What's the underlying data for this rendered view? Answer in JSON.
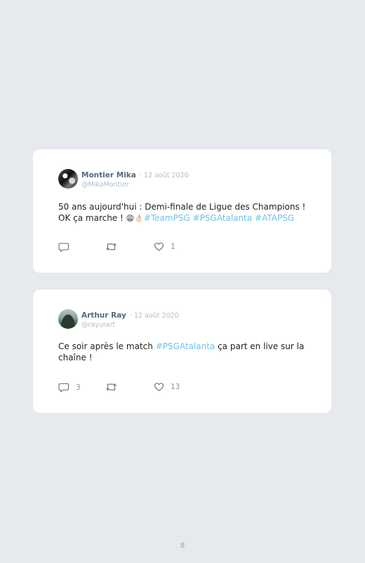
{
  "tweets": [
    {
      "name": "Montier Mika",
      "date": "· 12 août 2020",
      "handle": "@MikaMontier",
      "text_plain": "50 ans aujourd'hui : Demi-finale de Ligue des Champions !",
      "text_line2_plain": "OK ça marche ! ",
      "emoji": "😩👌🏻",
      "hashtags": [
        "#TeamPSG",
        "#PSGAtalanta",
        "#ATAPSG"
      ],
      "reply_count": "",
      "retweet_count": "",
      "like_count": "1"
    },
    {
      "name": "Arthur Ray",
      "date": "· 12 août 2020",
      "handle": "@rayurart",
      "text_before": "Ce soir après le match ",
      "hashtag": "#PSGAtalanta",
      "text_after": " ça part en live sur la chaîne !",
      "reply_count": "3",
      "retweet_count": "",
      "like_count": "13"
    }
  ],
  "page_number": "8",
  "icons": {
    "reply": "reply-icon",
    "retweet": "retweet-icon",
    "like": "heart-icon"
  },
  "colors": {
    "background": "#e6e9ed",
    "card": "#ffffff",
    "name": "#556b82",
    "meta": "#b4bcc5",
    "hashtag": "#6fc3ea",
    "icon": "#6a7886"
  }
}
